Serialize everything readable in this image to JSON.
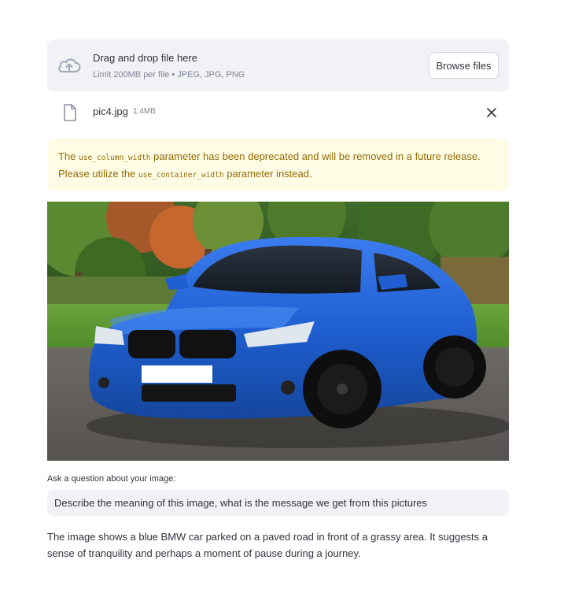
{
  "uploader": {
    "title": "Drag and drop file here",
    "subtitle": "Limit 200MB per file • JPEG, JPG, PNG",
    "browse_label": "Browse files"
  },
  "file": {
    "name": "pic4.jpg",
    "size": "1.4MB"
  },
  "warning": {
    "part1": "The ",
    "code1": "use_column_width",
    "part2": " parameter has been deprecated and will be removed in a future release. Please utilize the ",
    "code2": "use_container_width",
    "part3": " parameter instead."
  },
  "question": {
    "label": "Ask a question about your image:",
    "value": "Describe the meaning of this image, what is the message we get from this pictures"
  },
  "answer": "The image shows a blue BMW car parked on a paved road in front of a grassy area. It suggests a sense of tranquility and perhaps a moment of pause during a journey.",
  "colors": {
    "accent_bg": "#f0f2f6",
    "warning_bg": "#fffce6",
    "warning_text": "#926c05",
    "car_blue": "#1f5fd1"
  }
}
